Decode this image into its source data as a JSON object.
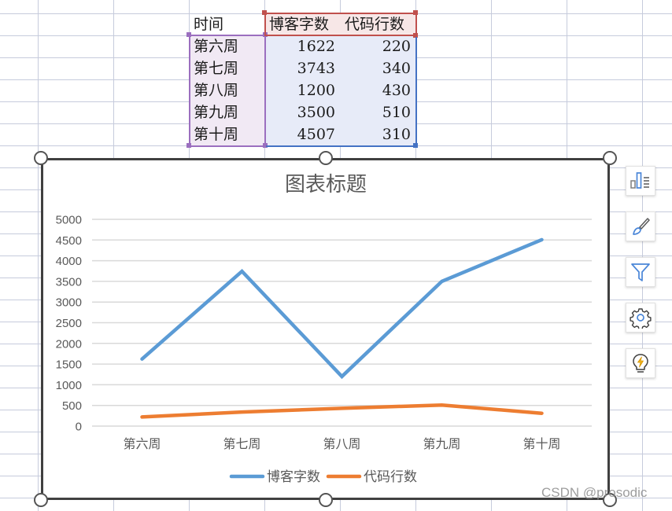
{
  "sheet": {
    "header_row": [
      "时间",
      "博客字数",
      "代码行数"
    ],
    "rows": [
      {
        "label": "第六周",
        "blog_words": "1622",
        "code_lines": "220"
      },
      {
        "label": "第七周",
        "blog_words": "3743",
        "code_lines": "340"
      },
      {
        "label": "第八周",
        "blog_words": "1200",
        "code_lines": "430"
      },
      {
        "label": "第九周",
        "blog_words": "3500",
        "code_lines": "510"
      },
      {
        "label": "第十周",
        "blog_words": "4507",
        "code_lines": "310"
      }
    ],
    "colors": {
      "gridline": "#c6cbdc",
      "category_range": "#9b6fbf",
      "series_name_range": "#c0504d",
      "values_range": "#4472c4"
    }
  },
  "chart_data": {
    "type": "line",
    "title": "图表标题",
    "categories": [
      "第六周",
      "第七周",
      "第八周",
      "第九周",
      "第十周"
    ],
    "series": [
      {
        "name": "博客字数",
        "values": [
          1622,
          3743,
          1200,
          3500,
          4507
        ],
        "color": "#5b9bd5"
      },
      {
        "name": "代码行数",
        "values": [
          220,
          340,
          430,
          510,
          310
        ],
        "color": "#ed7d31"
      }
    ],
    "xlabel": "",
    "ylabel": "",
    "ylim": [
      0,
      5000
    ],
    "yticks": [
      "0",
      "500",
      "1000",
      "1500",
      "2000",
      "2500",
      "3000",
      "3500",
      "4000",
      "4500",
      "5000"
    ],
    "ytick_step": 500,
    "grid": true,
    "legend_position": "bottom"
  },
  "side_toolbar": {
    "buttons": [
      {
        "name": "chart-elements-button",
        "icon": "chart-elements-icon"
      },
      {
        "name": "chart-styles-button",
        "icon": "paintbrush-icon"
      },
      {
        "name": "chart-filters-button",
        "icon": "filter-icon"
      },
      {
        "name": "chart-settings-button",
        "icon": "gear-icon"
      },
      {
        "name": "chart-ideas-button",
        "icon": "lightbulb-icon"
      }
    ]
  },
  "watermark": "CSDN @prosodic"
}
